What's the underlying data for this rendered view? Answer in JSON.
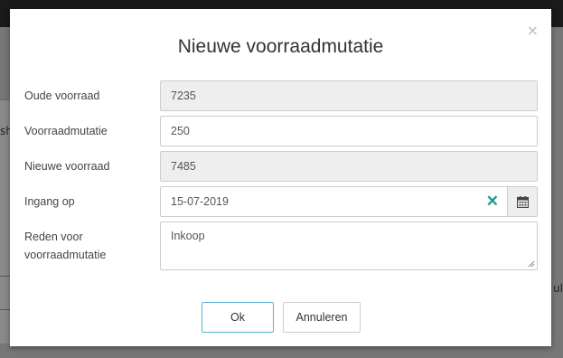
{
  "background": {
    "left_text": "sh",
    "right_text": "ul"
  },
  "modal": {
    "title": "Nieuwe voorraadmutatie",
    "close_label": "×",
    "fields": {
      "old_stock": {
        "label": "Oude voorraad",
        "value": "7235"
      },
      "mutation": {
        "label": "Voorraadmutatie",
        "value": "250"
      },
      "new_stock": {
        "label": "Nieuwe voorraad",
        "value": "7485"
      },
      "start_date": {
        "label": "Ingang op",
        "value": "15-07-2019"
      },
      "reason": {
        "label_line1": "Reden voor",
        "label_line2": "voorraadmutatie",
        "value": "Inkoop"
      }
    },
    "buttons": {
      "ok": "Ok",
      "cancel": "Annuleren"
    },
    "colors": {
      "clear_icon": "#1a9a94",
      "ok_border": "#5bb0e0"
    },
    "icons": {
      "clear": "clear-icon",
      "calendar": "calendar-icon",
      "close": "close-icon"
    }
  }
}
